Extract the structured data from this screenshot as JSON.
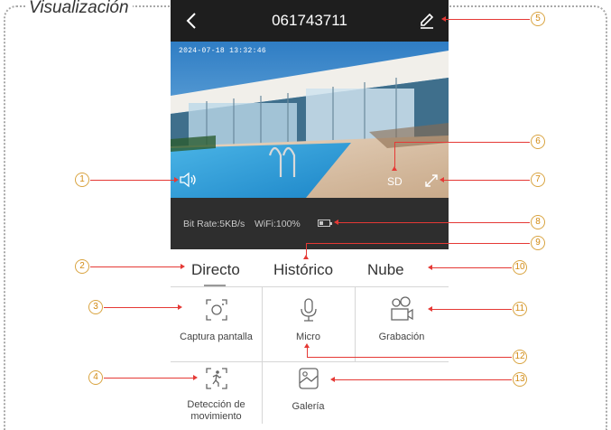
{
  "section_title": "Visualización",
  "header": {
    "title": "061743711",
    "back_icon": "back-arrow-icon",
    "edit_icon": "pencil-icon"
  },
  "video": {
    "timestamp": "2024-07-18 13:32:46",
    "speaker_icon": "speaker-icon",
    "sd_label": "SD",
    "fullscreen_icon": "fullscreen-icon"
  },
  "status": {
    "bitrate": "Bit Rate:5KB/s",
    "wifi": "WiFi:100%",
    "battery_level": 0.35
  },
  "tabs": [
    {
      "label": "Directo",
      "active": true
    },
    {
      "label": "Histórico",
      "active": false
    },
    {
      "label": "Nube",
      "active": false
    }
  ],
  "actions": {
    "capture": "Captura pantalla",
    "micro": "Micro",
    "record": "Grabación",
    "motion_line1": "Detección de",
    "motion_line2": "movimiento",
    "gallery": "Galería"
  },
  "callouts": [
    "1",
    "2",
    "3",
    "4",
    "5",
    "6",
    "7",
    "8",
    "9",
    "10",
    "11",
    "12",
    "13"
  ],
  "colors": {
    "callout_line": "#e53935",
    "badge": "#d28a12",
    "topbar": "#1e1e1e",
    "statusbar": "#2e2e2e"
  }
}
